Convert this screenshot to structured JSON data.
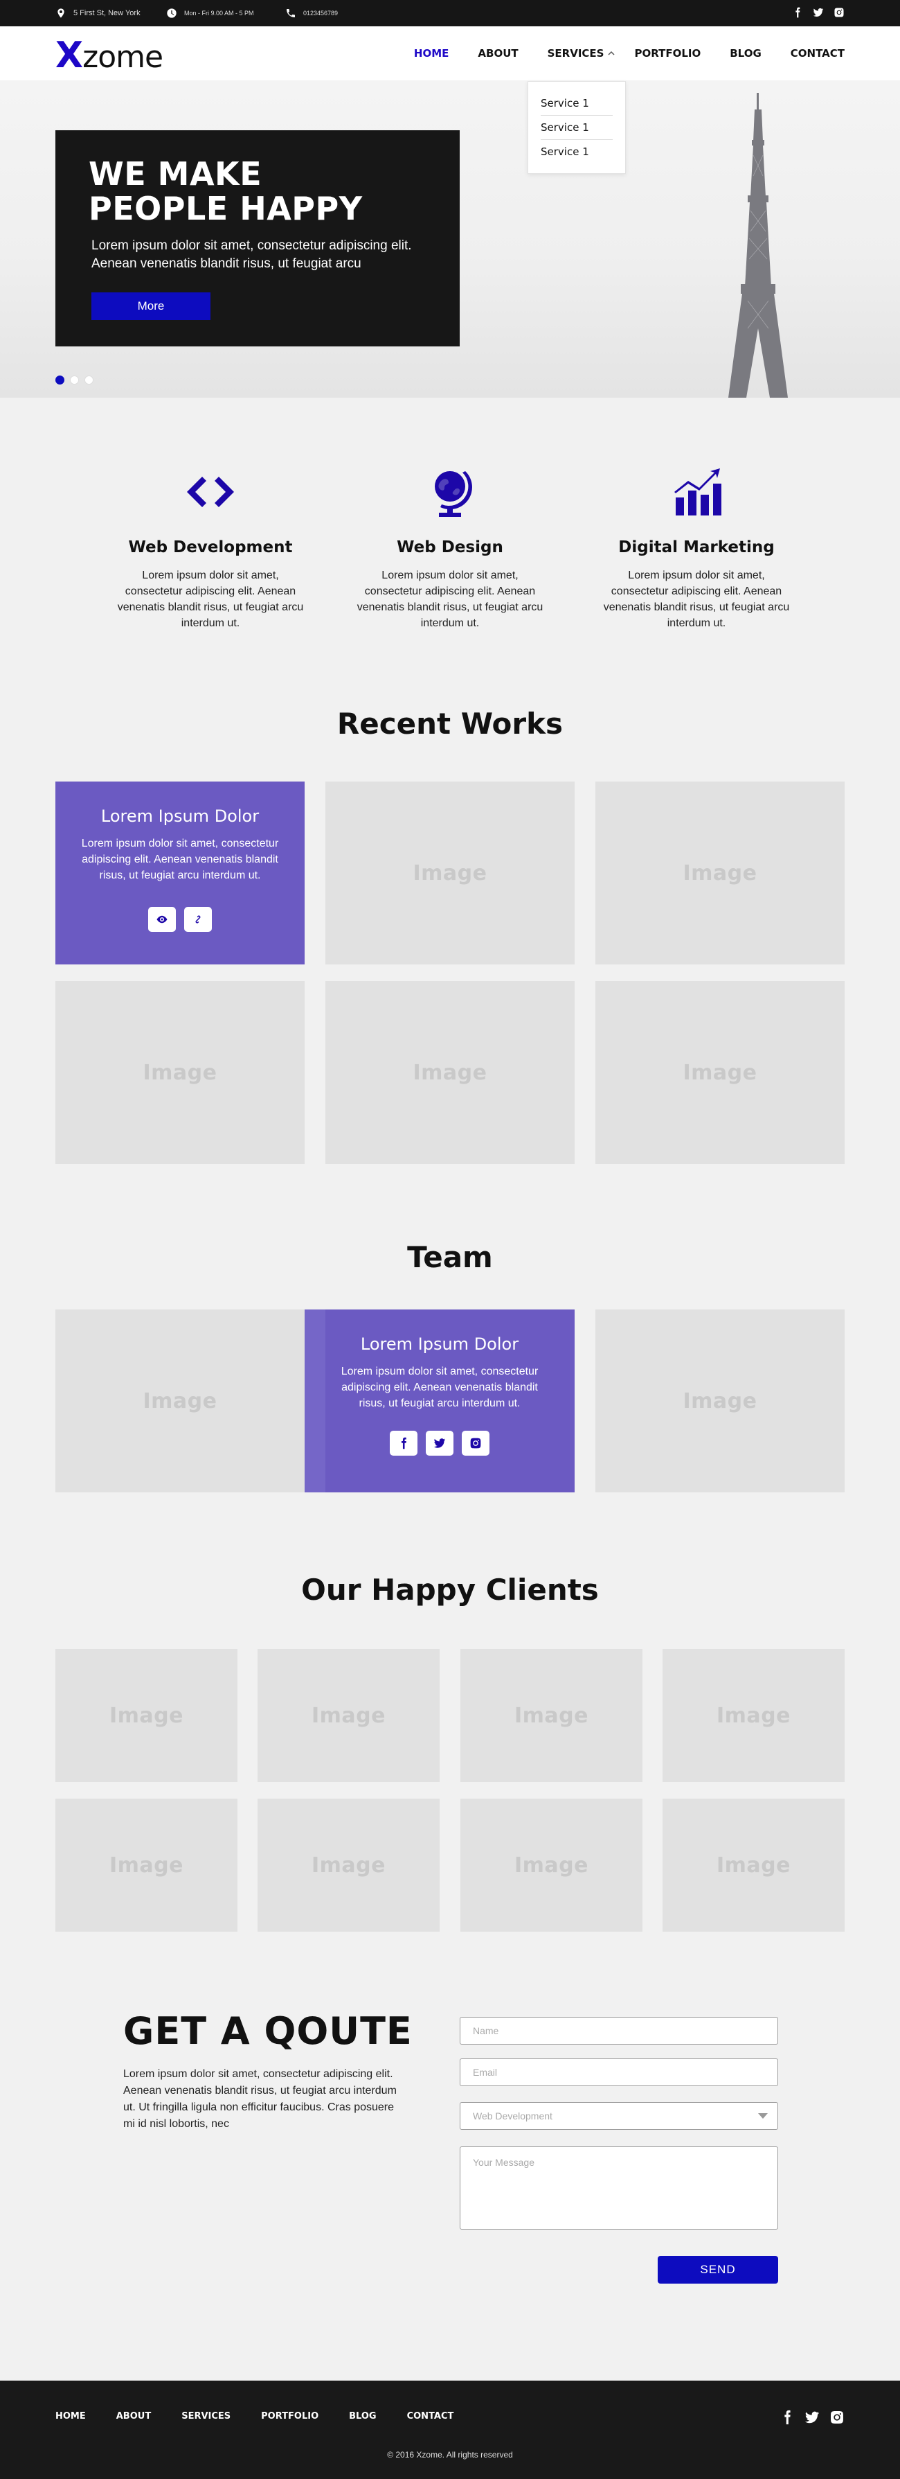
{
  "colors": {
    "accent": "#0d0cbf",
    "card_purple": "#6b5ac2",
    "dark": "#171717",
    "placeholder": "#e1e1e1"
  },
  "topbar": {
    "address": "5 First St, New York",
    "hours": "Mon - Fri 9.00 AM - 5 PM",
    "phone": "0123456789",
    "social_icons": [
      "facebook-icon",
      "twitter-icon",
      "instagram-icon"
    ]
  },
  "header": {
    "logo_x": "X",
    "logo_rest": "zome",
    "nav": [
      {
        "label": "HOME",
        "active": true
      },
      {
        "label": "ABOUT"
      },
      {
        "label": "SERVICES"
      },
      {
        "label": "PORTFOLIO"
      },
      {
        "label": "BLOG"
      },
      {
        "label": "CONTACT"
      }
    ],
    "services_dropdown": [
      "Service 1",
      "Service 1",
      "Service 1"
    ]
  },
  "hero": {
    "title": "WE MAKE\nPEOPLE HAPPY",
    "text": "Lorem ipsum dolor sit amet, consectetur adipiscing elit. Aenean venenatis blandit risus, ut feugiat arcu",
    "button": "More",
    "slides": 3,
    "active_slide": 1
  },
  "services": [
    {
      "icon": "code-icon",
      "title": "Web Development",
      "text": "Lorem ipsum dolor sit amet, consectetur adipiscing elit. Aenean venenatis blandit risus, ut feugiat arcu interdum ut."
    },
    {
      "icon": "globe-icon",
      "title": "Web Design",
      "text": "Lorem ipsum dolor sit amet, consectetur adipiscing elit. Aenean venenatis blandit risus, ut feugiat arcu interdum ut."
    },
    {
      "icon": "chart-icon",
      "title": "Digital Marketing",
      "text": "Lorem ipsum dolor sit amet, consectetur adipiscing elit. Aenean venenatis blandit risus, ut feugiat arcu interdum ut."
    }
  ],
  "works": {
    "title": "Recent Works",
    "card_title": "Lorem Ipsum Dolor",
    "card_text": "Lorem ipsum dolor sit amet, consectetur adipiscing elit. Aenean venenatis blandit risus, ut feugiat arcu interdum ut.",
    "placeholder": "Image"
  },
  "team": {
    "title": "Team",
    "card_title": "Lorem Ipsum Dolor",
    "card_text": "Lorem ipsum dolor sit amet, consectetur adipiscing elit. Aenean venenatis blandit risus, ut feugiat arcu interdum ut.",
    "placeholder": "Image"
  },
  "clients": {
    "title": "Our Happy Clients",
    "placeholder": "Image"
  },
  "quote": {
    "title": "GET A QOUTE",
    "text": "Lorem ipsum dolor sit amet, consectetur adipiscing elit. Aenean venenatis blandit risus, ut feugiat arcu interdum ut. Ut fringilla ligula non efficitur faucibus. Cras posuere mi id nisl lobortis, nec",
    "name_placeholder": "Name",
    "email_placeholder": "Email",
    "service_selected": "Web Development",
    "message_placeholder": "Your Message",
    "send": "SEND"
  },
  "footer": {
    "nav": [
      "HOME",
      "ABOUT",
      "SERVICES",
      "PORTFOLIO",
      "BLOG",
      "CONTACT"
    ],
    "copyright": "© 2016 Xzome. All rights reserved"
  }
}
